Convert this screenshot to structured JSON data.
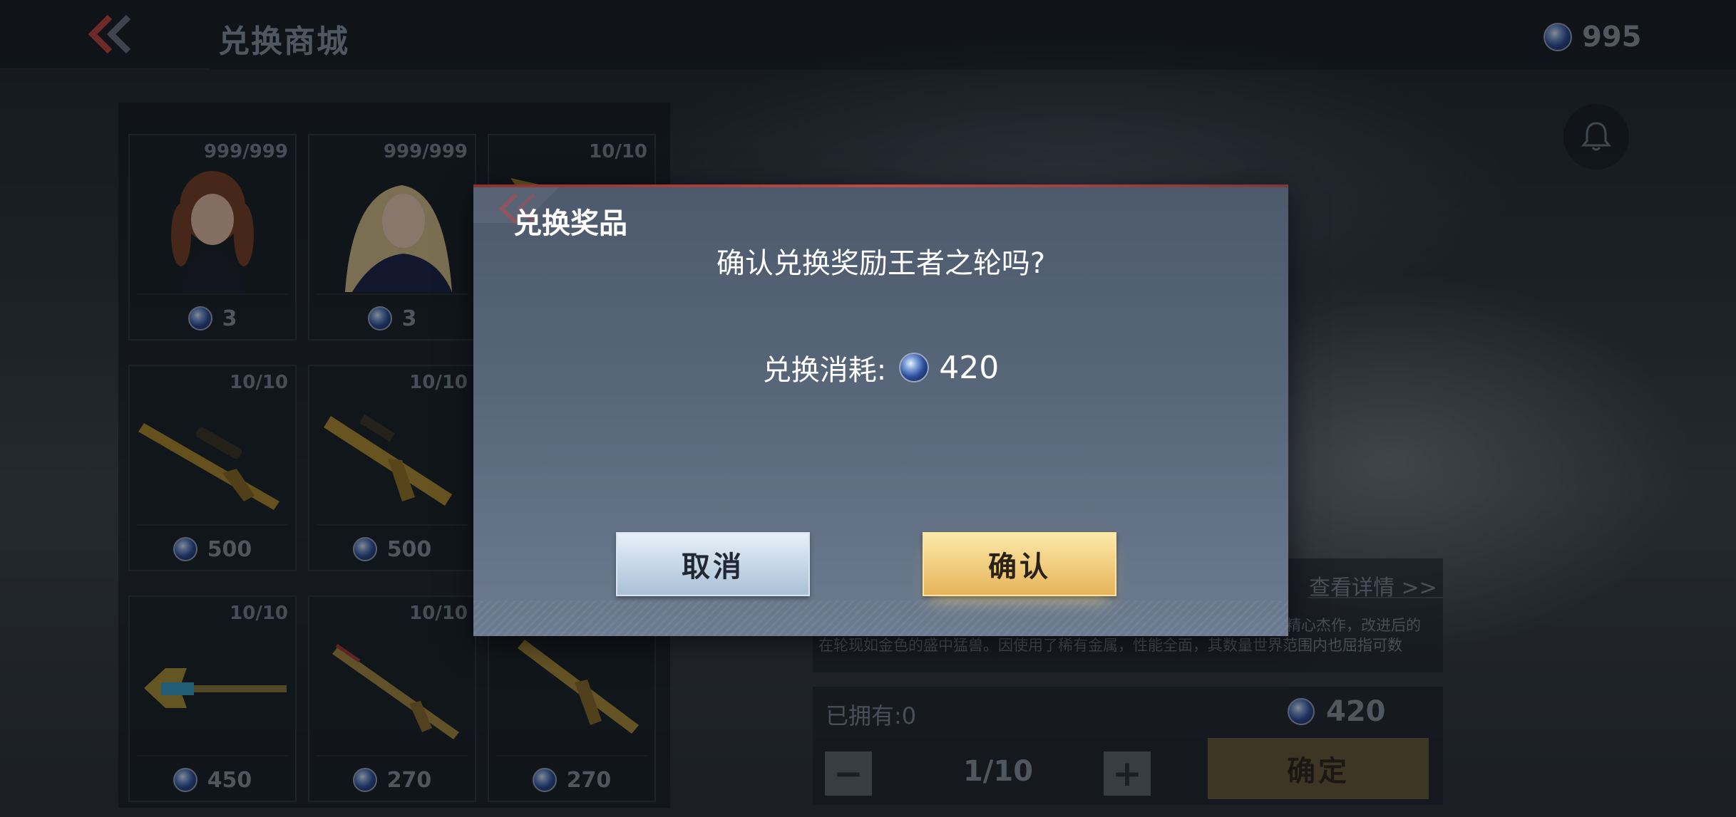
{
  "header": {
    "title": "兑换商城",
    "currency_value": "995"
  },
  "shop": {
    "items": [
      {
        "stock": "999/999",
        "price": "3",
        "art": "character-female-twin-tails"
      },
      {
        "stock": "999/999",
        "price": "3",
        "art": "character-female-blonde"
      },
      {
        "stock": "10/10",
        "price": "",
        "art": "gold-rifle"
      },
      {
        "stock": "10/10",
        "price": "500",
        "art": "gold-sniper-rifle"
      },
      {
        "stock": "10/10",
        "price": "500",
        "art": "gold-assault-rifle"
      },
      {
        "stock": "",
        "price": "",
        "art": "hidden"
      },
      {
        "stock": "10/10",
        "price": "450",
        "art": "gold-blue-launcher"
      },
      {
        "stock": "10/10",
        "price": "270",
        "art": "gold-ak-rifle"
      },
      {
        "stock": "",
        "price": "270",
        "art": "gold-m4-rifle"
      }
    ]
  },
  "detail": {
    "link": "查看详情 >>",
    "desc_line1": "精心杰作，改进后的",
    "desc_line2": "在轮现如金色的盛中猛兽。因使用了稀有金属，性能全面，其数量世界范围内也屈指可数"
  },
  "purchase": {
    "owned": "已拥有:0",
    "price": "420",
    "minus": "−",
    "plus": "+",
    "quantity": "1/10",
    "confirm": "确定"
  },
  "modal": {
    "title": "兑换奖品",
    "question": "确认兑换奖励王者之轮吗?",
    "cost_label": "兑换消耗:",
    "cost_value": "420",
    "cancel": "取消",
    "ok": "确认"
  },
  "colors": {
    "accent_red": "#c14848",
    "ok_button": "#e6b45a",
    "cancel_button": "#aac0d6"
  }
}
